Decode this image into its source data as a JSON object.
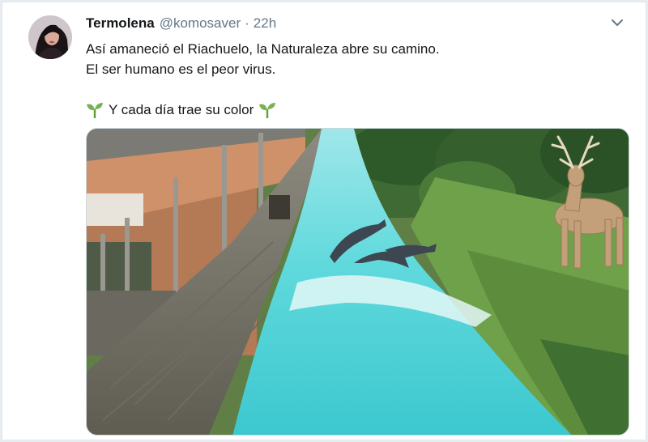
{
  "tweet": {
    "author_name": "Termolena",
    "handle": "@komosaver",
    "separator": "·",
    "time": "22h",
    "text_line1": "Así amaneció el Riachuelo, la Naturaleza abre su camino.",
    "text_line2": "El ser humano es el peor virus.",
    "text_line3": "Y cada día trae su color"
  },
  "icons": {
    "menu": "chevron-down-icon",
    "emoji": "seedling-icon"
  },
  "colors": {
    "water": "#48d3d6",
    "text": "#14171a",
    "muted": "#657786"
  }
}
